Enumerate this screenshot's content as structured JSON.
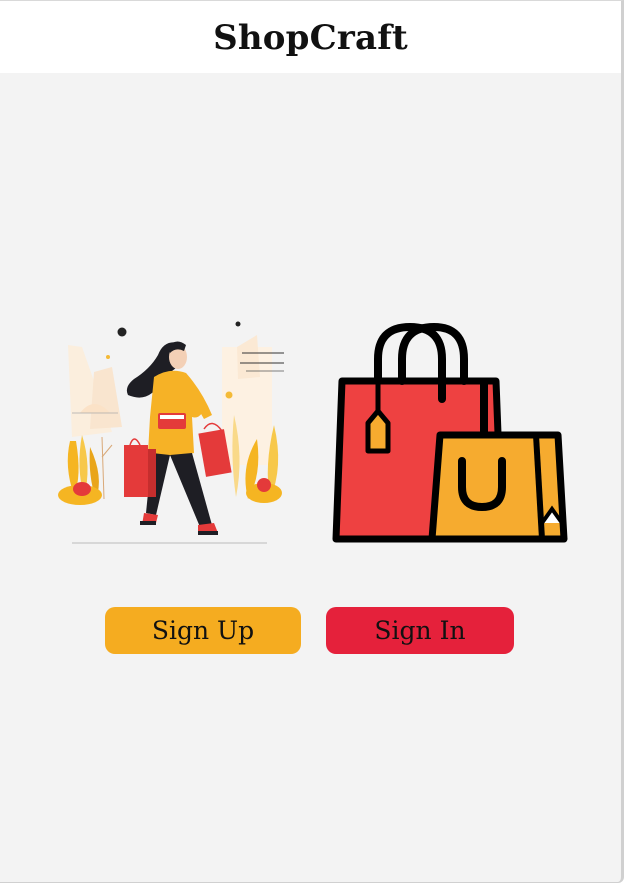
{
  "app": {
    "title": "ShopCraft"
  },
  "hero": {
    "illustration_icon": "woman-shopping-illustration",
    "logo_icon": "shopping-bags-icon"
  },
  "actions": {
    "sign_up_label": "Sign Up",
    "sign_in_label": "Sign In"
  },
  "colors": {
    "background": "#f3f3f3",
    "header": "#ffffff",
    "sign_up": "#f5ac20",
    "sign_in": "#e5213b",
    "bag_red": "#ee4141",
    "bag_yellow": "#f6ab2f"
  }
}
